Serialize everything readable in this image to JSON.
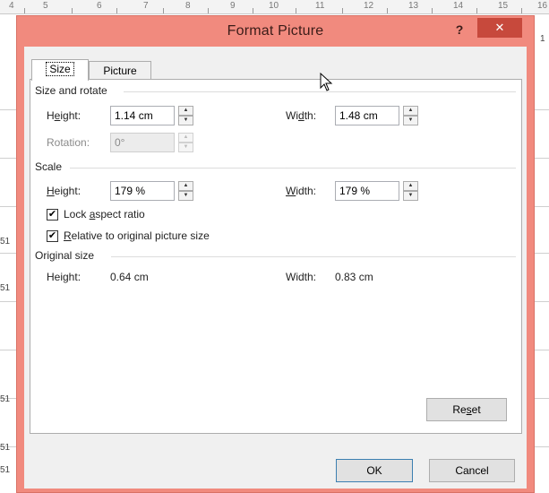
{
  "background": {
    "ruler_numbers": [
      "4",
      "5",
      "6",
      "7",
      "8",
      "9",
      "10",
      "11",
      "12",
      "13",
      "14",
      "15"
    ],
    "left_cell_texts": [
      "51",
      "51",
      "51",
      "51",
      "51"
    ],
    "right_cell_text": "1",
    "right_ruler_number": "16"
  },
  "dialog": {
    "title": "Format Picture",
    "help_label": "?",
    "close_label": "✕",
    "tabs": [
      {
        "label": "Size",
        "active": true
      },
      {
        "label": "Picture",
        "active": false
      }
    ],
    "size_and_rotate": {
      "title": "Size and rotate",
      "height_label_pre": "H",
      "height_label_u": "e",
      "height_label_post": "ight:",
      "height_value": "1.14 cm",
      "width_label_pre": "Wi",
      "width_label_u": "d",
      "width_label_post": "th:",
      "width_value": "1.48 cm",
      "rotation_label": "Rotation:",
      "rotation_value": "0°"
    },
    "scale": {
      "title": "Scale",
      "height_label_u": "H",
      "height_label_post": "eight:",
      "height_value": "179 %",
      "width_label_u": "W",
      "width_label_post": "idth:",
      "width_value": "179 %",
      "lock_pre": "Lock ",
      "lock_u": "a",
      "lock_post": "spect ratio",
      "lock_checked": true,
      "relative_u": "R",
      "relative_post": "elative to original picture size",
      "relative_checked": true
    },
    "original_size": {
      "title": "Original size",
      "height_label": "Height:",
      "height_value": "0.64 cm",
      "width_label": "Width:",
      "width_value": "0.83 cm"
    },
    "reset_pre": "Re",
    "reset_u": "s",
    "reset_post": "et",
    "ok_label": "OK",
    "cancel_label": "Cancel",
    "check_glyph": "✔"
  },
  "colors": {
    "dialog_frame": "#f18a7e",
    "close_button": "#c7493c",
    "client_bg": "#f0f0f0"
  }
}
